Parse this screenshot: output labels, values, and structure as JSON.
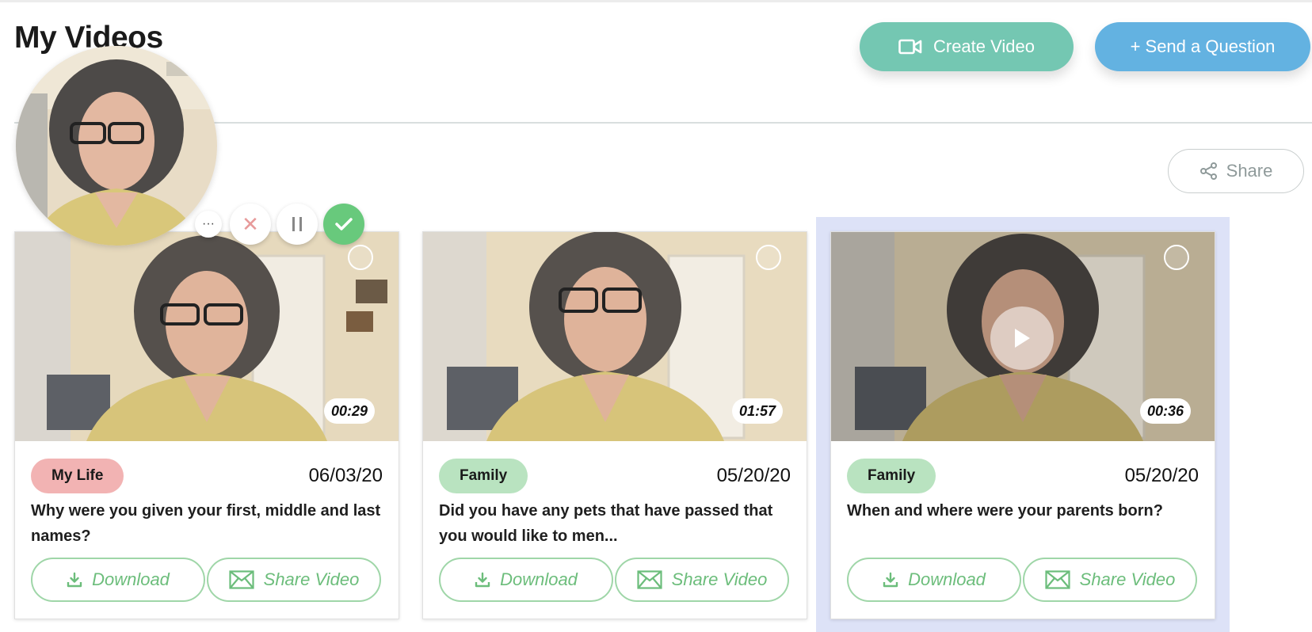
{
  "page": {
    "title": "My Videos"
  },
  "header": {
    "create_video_label": "Create Video",
    "create_video_icon": "video-camera-icon",
    "send_question_label": "+ Send a Question",
    "share_label": "Share",
    "share_icon": "share-nodes-icon"
  },
  "recorder": {
    "controls": [
      {
        "name": "more-options",
        "glyph": "···",
        "icon": "ellipsis-icon"
      },
      {
        "name": "cancel-recording",
        "glyph": "✕",
        "icon": "close-icon"
      },
      {
        "name": "pause-recording",
        "glyph": "⏸",
        "icon": "pause-icon"
      },
      {
        "name": "confirm-recording",
        "glyph": "✓",
        "icon": "check-icon"
      }
    ]
  },
  "colors": {
    "create_button": "#74c7b2",
    "send_button": "#63b2e1",
    "tag_my_life": "#f2b3b3",
    "tag_family": "#b9e3c0",
    "action_green": "#6cbd7b",
    "selected_card": "#dde2f7"
  },
  "videos": [
    {
      "duration": "00:29",
      "tag": "My Life",
      "tag_color": "#f2b3b3",
      "date": "06/03/20",
      "question": "Why were you given your first, middle and last names?",
      "download_label": "Download",
      "share_label": "Share Video",
      "selected": false
    },
    {
      "duration": "01:57",
      "tag": "Family",
      "tag_color": "#b9e3c0",
      "date": "05/20/20",
      "question": "Did you have any pets that have passed that you would like to men...",
      "download_label": "Download",
      "share_label": "Share Video",
      "selected": false
    },
    {
      "duration": "00:36",
      "tag": "Family",
      "tag_color": "#b9e3c0",
      "date": "05/20/20",
      "question": "When and where were your parents born?",
      "download_label": "Download",
      "share_label": "Share Video",
      "selected": true
    }
  ]
}
